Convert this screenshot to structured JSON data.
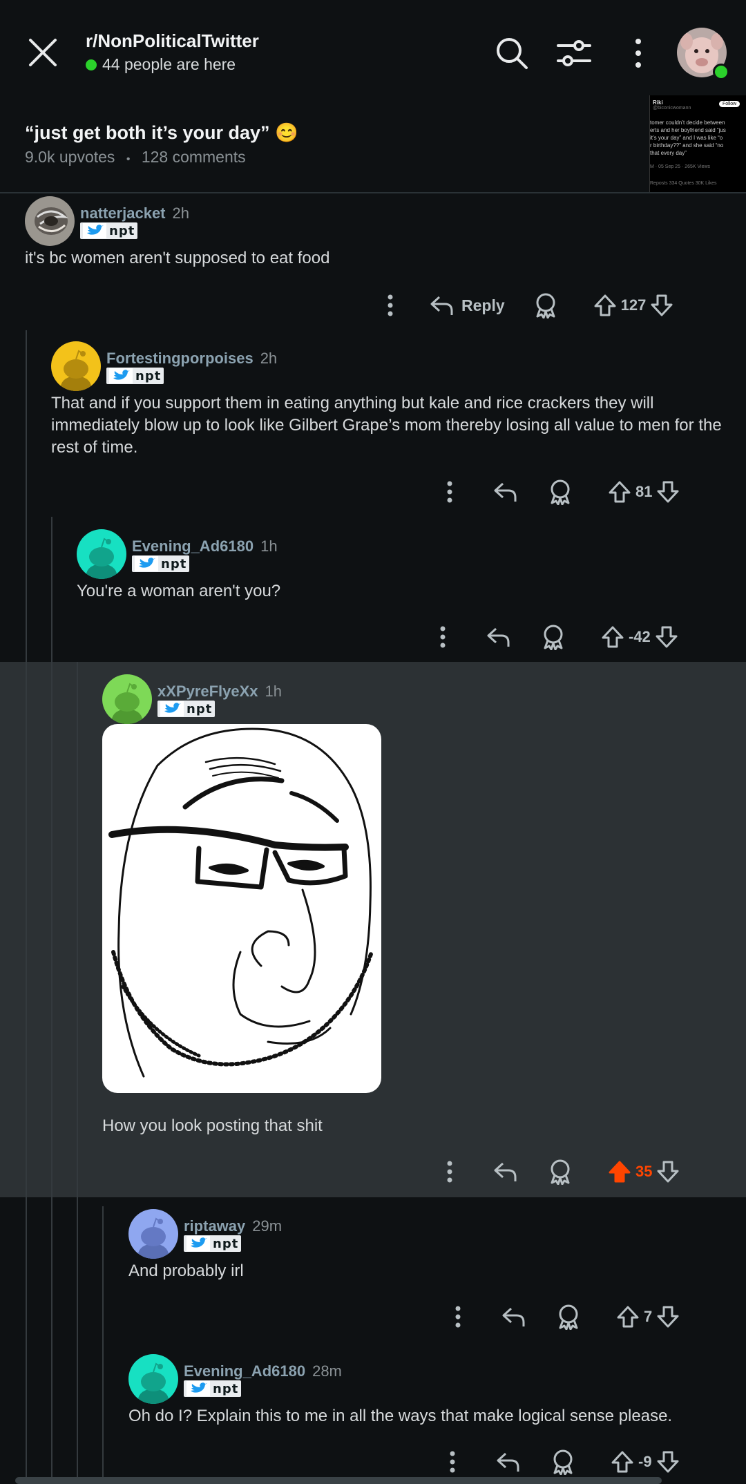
{
  "header": {
    "subreddit": "r/NonPoliticalTwitter",
    "online": "44 people are here"
  },
  "post": {
    "title": "“just get both it’s your day” 😊",
    "upvotes": "9.0k upvotes",
    "separator": "•",
    "comments": "128 comments",
    "thumbnail": {
      "name": "Riki",
      "handle": "@biconicwomann",
      "follow": "Follow",
      "lines": [
        "tomer couldn’t decide between",
        "erts and her boyfriend said “jus",
        "it’s your day” and I was like “o",
        "r birthday??” and she said “no",
        "that every day”"
      ],
      "time": "M · 05 Sep 25 · 265K Views",
      "stats": "Reposts  334 Quotes  30K  Likes"
    }
  },
  "flair_text": "npt",
  "reply_label": "Reply",
  "comments": [
    {
      "user": "natterjacket",
      "time": "2h",
      "text": "it's bc women aren't supposed to eat food",
      "votes": "127"
    },
    {
      "user": "Fortestingporpoises",
      "time": "2h",
      "text": "That and if you support them in eating anything but kale and rice crackers they will immediately blow up to look like Gilbert Grape’s mom thereby losing all value to men for the rest of time.",
      "votes": "81"
    },
    {
      "user": "Evening_Ad6180",
      "time": "1h",
      "text": "You're a woman aren't you?",
      "votes": "-42"
    },
    {
      "user": "xXPyreFlyeXx",
      "time": "1h",
      "text": "How you look posting that shit",
      "votes": "35"
    },
    {
      "user": "riptaway",
      "time": "29m",
      "text": "And probably irl",
      "votes": "7"
    },
    {
      "user": "Evening_Ad6180",
      "time": "28m",
      "text": "Oh do I? Explain this to me in all the ways that make logical sense please.",
      "votes": "-9"
    }
  ],
  "colors": {
    "background": "#0e1113",
    "highlight": "#2c3134",
    "upvote_active": "#ff4500",
    "username": "#8ba2b0",
    "online_dot": "#2bd12b"
  }
}
